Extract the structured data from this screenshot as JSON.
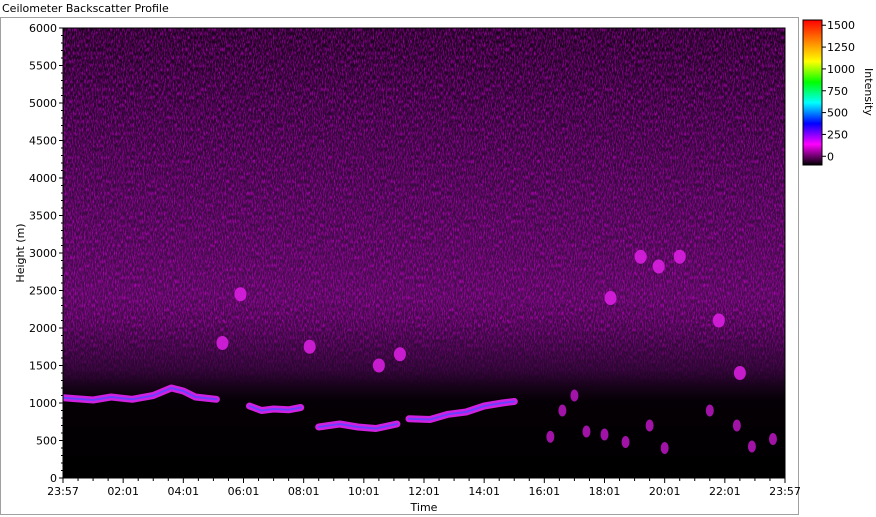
{
  "window": {
    "title": "Ceilometer Backscatter Profile"
  },
  "chart_data": {
    "type": "heatmap",
    "title": "",
    "xlabel": "Time",
    "ylabel": "Height (m)",
    "ylim": [
      0,
      6000
    ],
    "yticks": [
      0,
      500,
      1000,
      1500,
      2000,
      2500,
      3000,
      3500,
      4000,
      4500,
      5000,
      5500,
      6000
    ],
    "xticks": [
      "23:57",
      "02:01",
      "04:01",
      "06:01",
      "08:01",
      "10:01",
      "12:01",
      "14:01",
      "16:01",
      "18:01",
      "20:01",
      "22:01",
      "23:57"
    ],
    "colorbar": {
      "label": "Intensity",
      "range": [
        -100,
        1560
      ],
      "ticks": [
        0,
        250,
        500,
        750,
        1000,
        1250,
        1500
      ],
      "tick_labels": [
        "0",
        "250",
        "500",
        "750",
        "1000",
        "1250",
        "1500"
      ],
      "colors": [
        "#000000",
        "#ff00ff",
        "#0000ff",
        "#00ffff",
        "#00ff00",
        "#ffff00",
        "#ff8000",
        "#ff0000"
      ]
    },
    "grid": false,
    "cloud_layer": {
      "name": "",
      "segments": [
        {
          "points": [
            [
              0,
              1070
            ],
            [
              1.0,
              1040
            ],
            [
              1.6,
              1080
            ],
            [
              2.3,
              1050
            ],
            [
              3.0,
              1100
            ],
            [
              3.6,
              1200
            ],
            [
              4.0,
              1160
            ],
            [
              4.4,
              1080
            ],
            [
              5.1,
              1050
            ]
          ]
        },
        {
          "points": [
            [
              6.2,
              960
            ],
            [
              6.6,
              900
            ],
            [
              7.0,
              920
            ],
            [
              7.5,
              910
            ],
            [
              7.9,
              940
            ]
          ]
        },
        {
          "points": [
            [
              8.5,
              680
            ],
            [
              9.2,
              720
            ],
            [
              9.8,
              680
            ],
            [
              10.4,
              660
            ],
            [
              11.1,
              720
            ]
          ]
        },
        {
          "points": [
            [
              11.5,
              790
            ],
            [
              12.2,
              780
            ],
            [
              12.8,
              850
            ],
            [
              13.4,
              880
            ],
            [
              14.0,
              960
            ],
            [
              14.6,
              1000
            ],
            [
              15.0,
              1020
            ]
          ]
        }
      ]
    },
    "elevated_patches": [
      [
        5.3,
        1800
      ],
      [
        5.9,
        2450
      ],
      [
        8.2,
        1750
      ],
      [
        10.5,
        1500
      ],
      [
        11.2,
        1650
      ],
      [
        18.2,
        2400
      ],
      [
        19.2,
        2950
      ],
      [
        19.8,
        2820
      ],
      [
        20.5,
        2950
      ],
      [
        21.8,
        2100
      ],
      [
        22.5,
        1400
      ]
    ],
    "scattered_echoes": [
      [
        16.2,
        550
      ],
      [
        16.6,
        900
      ],
      [
        17.0,
        1100
      ],
      [
        17.4,
        620
      ],
      [
        18.0,
        580
      ],
      [
        18.7,
        480
      ],
      [
        19.5,
        700
      ],
      [
        20.0,
        400
      ],
      [
        21.5,
        900
      ],
      [
        22.4,
        700
      ],
      [
        22.9,
        420
      ],
      [
        23.6,
        520
      ]
    ]
  }
}
